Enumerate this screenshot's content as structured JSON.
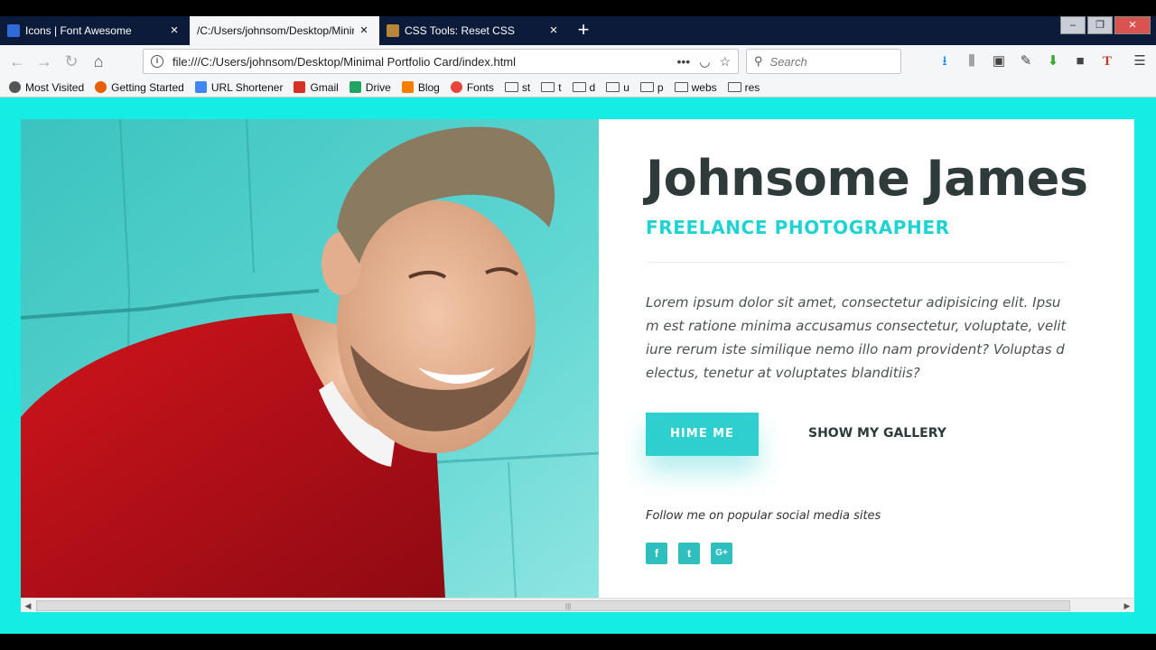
{
  "browser": {
    "tabs": [
      {
        "title": "Icons | Font Awesome",
        "favicon": "flag-icon",
        "active": false
      },
      {
        "title": "/C:/Users/johnsom/Desktop/Minim",
        "favicon": "",
        "active": true
      },
      {
        "title": "CSS Tools: Reset CSS",
        "favicon": "tools-icon",
        "active": false
      }
    ],
    "url": "file:///C:/Users/johnsom/Desktop/Minimal Portfolio Card/index.html",
    "search_placeholder": "Search",
    "bookmarks": [
      {
        "label": "Most Visited",
        "icon": "gear-icon",
        "color": "#555555"
      },
      {
        "label": "Getting Started",
        "icon": "firefox-icon",
        "color": "#e66000"
      },
      {
        "label": "URL Shortener",
        "icon": "google-icon",
        "color": "#4285f4"
      },
      {
        "label": "Gmail",
        "icon": "gmail-icon",
        "color": "#d93025"
      },
      {
        "label": "Drive",
        "icon": "drive-icon",
        "color": "#1fa463"
      },
      {
        "label": "Blog",
        "icon": "blogger-icon",
        "color": "#f57d00"
      },
      {
        "label": "Fonts",
        "icon": "fonts-icon",
        "color": "#e8453c"
      },
      {
        "label": "st",
        "icon": "folder-icon"
      },
      {
        "label": "t",
        "icon": "folder-icon"
      },
      {
        "label": "d",
        "icon": "folder-icon"
      },
      {
        "label": "u",
        "icon": "folder-icon"
      },
      {
        "label": "p",
        "icon": "folder-icon"
      },
      {
        "label": "webs",
        "icon": "folder-icon"
      },
      {
        "label": "res",
        "icon": "folder-icon"
      }
    ]
  },
  "page": {
    "background": "#14ece4",
    "accent": "#2fcfcf",
    "name": "Johnsome James",
    "role": "FREELANCE PHOTOGRAPHER",
    "bio": "Lorem ipsum dolor sit amet, consectetur adipisicing elit. Ipsum est ratione minima accusamus consectetur, voluptate, velit iure rerum iste similique nemo illo nam provident? Voluptas delectus, tenetur at voluptates blanditiis?",
    "hire_label": "HIME ME",
    "gallery_label": "SHOW MY GALLERY",
    "follow_text": "Follow me on popular social media sites",
    "social": [
      {
        "name": "facebook-icon",
        "glyph": "f"
      },
      {
        "name": "twitter-icon",
        "glyph": "t"
      },
      {
        "name": "google-plus-icon",
        "glyph": "G+"
      }
    ]
  }
}
